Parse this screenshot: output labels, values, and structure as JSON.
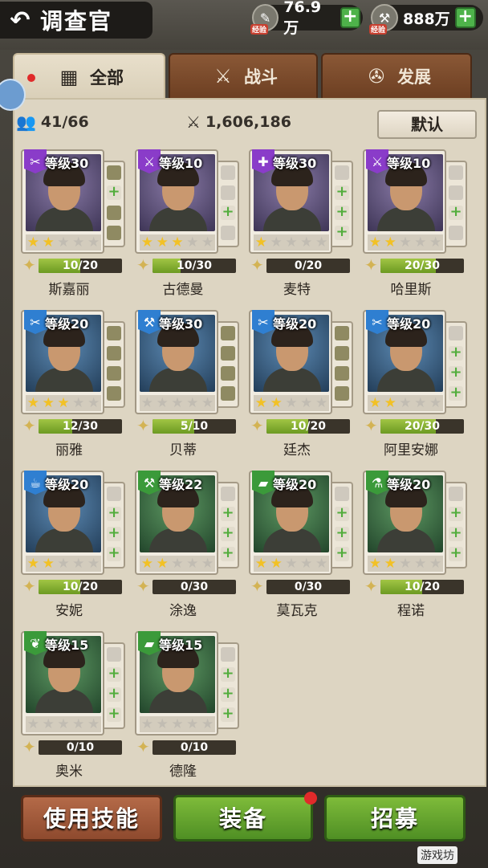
{
  "header": {
    "back_icon": "back-arrow-icon",
    "title": "调查官",
    "resource1": {
      "value": "76.9万",
      "label": "经验"
    },
    "resource2": {
      "value": "888万",
      "label": "经验"
    }
  },
  "tabs": [
    {
      "label": "全部",
      "icon": "grid-icon",
      "active": true
    },
    {
      "label": "战斗",
      "icon": "combat-icon",
      "active": false
    },
    {
      "label": "发展",
      "icon": "develop-icon",
      "active": false
    }
  ],
  "stats": {
    "count": "41/66",
    "power": "1,606,186",
    "sort_label": "默认"
  },
  "colors": {
    "purple": "#8a3cc9",
    "blue": "#2f7fd1",
    "green": "#3b9a3a",
    "progress": "#8fb83a"
  },
  "cards": [
    {
      "name": "斯嘉丽",
      "level": "等级30",
      "stars": 1.5,
      "progress": "10/20",
      "rarity": "purple",
      "icon": "tools-icon",
      "slots": [
        "eq",
        "add",
        "eq",
        "eq"
      ]
    },
    {
      "name": "古德曼",
      "level": "等级10",
      "stars": 2.5,
      "progress": "10/30",
      "rarity": "purple",
      "icon": "weapon-icon",
      "slots": [
        "empty",
        "empty",
        "add",
        "empty"
      ]
    },
    {
      "name": "麦特",
      "level": "等级30",
      "stars": 1,
      "progress": "0/20",
      "rarity": "purple",
      "icon": "medkit-icon",
      "slots": [
        "empty",
        "add",
        "add",
        "add"
      ]
    },
    {
      "name": "哈里斯",
      "level": "等级10",
      "stars": 2,
      "progress": "20/30",
      "rarity": "purple",
      "icon": "weapon-icon",
      "slots": [
        "empty",
        "empty",
        "add",
        "empty"
      ]
    },
    {
      "name": "丽雅",
      "level": "等级20",
      "stars": 2.5,
      "progress": "12/30",
      "rarity": "blue",
      "icon": "tools-icon",
      "slots": [
        "eq",
        "eq",
        "eq",
        "eq"
      ]
    },
    {
      "name": "贝蒂",
      "level": "等级30",
      "stars": 0,
      "progress": "5/10",
      "rarity": "blue",
      "icon": "hammer-icon",
      "slots": [
        "eq",
        "eq",
        "eq",
        "eq"
      ]
    },
    {
      "name": "廷杰",
      "level": "等级20",
      "stars": 1.5,
      "progress": "10/20",
      "rarity": "blue",
      "icon": "tools-icon",
      "slots": [
        "eq",
        "eq",
        "eq",
        "eq"
      ]
    },
    {
      "name": "阿里安娜",
      "level": "等级20",
      "stars": 2,
      "progress": "20/30",
      "rarity": "blue",
      "icon": "tools-icon",
      "slots": [
        "empty",
        "add",
        "add",
        "add"
      ]
    },
    {
      "name": "安妮",
      "level": "等级20",
      "stars": 1.5,
      "progress": "10/20",
      "rarity": "blue",
      "icon": "pot-icon",
      "slots": [
        "empty",
        "add",
        "add",
        "add"
      ]
    },
    {
      "name": "涂逸",
      "level": "等级22",
      "stars": 2,
      "progress": "0/30",
      "rarity": "green",
      "icon": "hammer-icon",
      "slots": [
        "empty",
        "add",
        "add",
        "add"
      ]
    },
    {
      "name": "莫瓦克",
      "level": "等级20",
      "stars": 2,
      "progress": "0/30",
      "rarity": "green",
      "icon": "bandage-icon",
      "slots": [
        "empty",
        "add",
        "add",
        "add"
      ]
    },
    {
      "name": "程诺",
      "level": "等级20",
      "stars": 1.5,
      "progress": "10/20",
      "rarity": "green",
      "icon": "flask-icon",
      "slots": [
        "empty",
        "add",
        "add",
        "add"
      ]
    },
    {
      "name": "奥米",
      "level": "等级15",
      "stars": 0,
      "progress": "0/10",
      "rarity": "green",
      "icon": "sprout-icon",
      "slots": [
        "empty",
        "add",
        "add",
        "add"
      ]
    },
    {
      "name": "德隆",
      "level": "等级15",
      "stars": 0,
      "progress": "0/10",
      "rarity": "green",
      "icon": "bandage-icon",
      "slots": [
        "empty",
        "add",
        "add",
        "add"
      ]
    }
  ],
  "buttons": {
    "skill": "使用技能",
    "equip": "装备",
    "recruit": "招募"
  },
  "watermark": "游戏坊"
}
